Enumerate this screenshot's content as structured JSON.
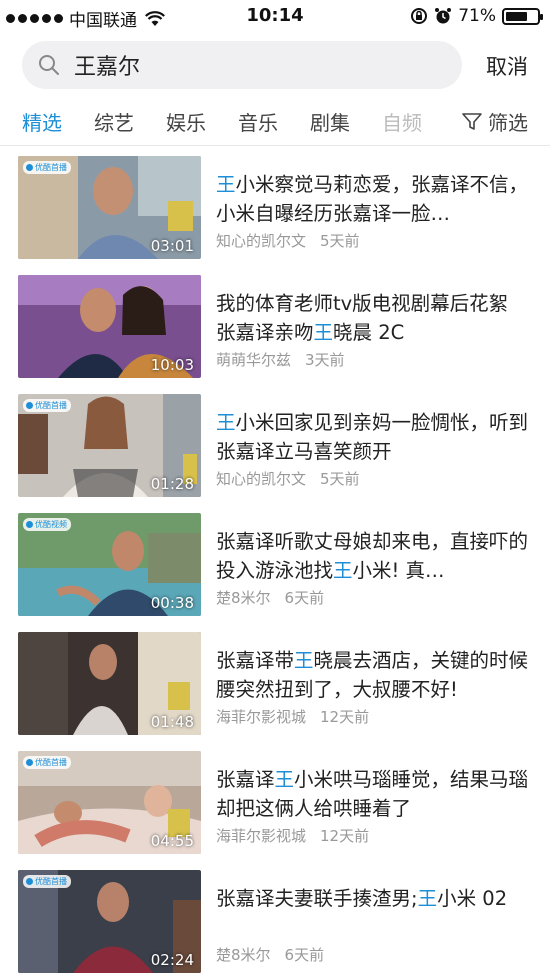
{
  "status_bar": {
    "carrier": "中国联通",
    "time": "10:14",
    "battery_percent": "71%",
    "battery_level": 0.71
  },
  "search": {
    "query": "王嘉尔",
    "cancel_label": "取消"
  },
  "tabs": {
    "items": [
      "精选",
      "综艺",
      "娱乐",
      "音乐",
      "剧集",
      "自频"
    ],
    "active": "精选",
    "filter_label": "筛选"
  },
  "results": [
    {
      "title_hl": "王",
      "title_rest": "小米察觉马莉恋爱，张嘉译不信，小米自曝经历张嘉译一脸…",
      "channel": "知心的凯尔文",
      "time": "5天前",
      "duration": "03:01",
      "badge": "优酷首播"
    },
    {
      "title_pre": "我的体育老师tv版电视剧幕后花絮 张嘉译亲吻",
      "title_hl": "王",
      "title_rest": "晓晨 2C",
      "channel": "萌萌华尔兹",
      "time": "3天前",
      "duration": "10:03"
    },
    {
      "title_hl": "王",
      "title_rest": "小米回家见到亲妈一脸惆怅，听到张嘉译立马喜笑颜开",
      "channel": "知心的凯尔文",
      "time": "5天前",
      "duration": "01:28",
      "badge": "优酷首播"
    },
    {
      "title_pre": "张嘉译听歌丈母娘却来电，直接吓的投入游泳池找",
      "title_hl": "王",
      "title_rest": "小米! 真…",
      "channel": "楚8米尔",
      "time": "6天前",
      "duration": "00:38",
      "badge": "优酷视频"
    },
    {
      "title_pre": "张嘉译带",
      "title_hl": "王",
      "title_rest": "晓晨去酒店，关键的时候腰突然扭到了，大叔腰不好!",
      "channel": "海菲尔影视城",
      "time": "12天前",
      "duration": "01:48"
    },
    {
      "title_pre": "张嘉译",
      "title_hl": "王",
      "title_rest": "小米哄马瑙睡觉，结果马瑙却把这俩人给哄睡着了",
      "channel": "海菲尔影视城",
      "time": "12天前",
      "duration": "04:55",
      "badge": "优酷首播"
    },
    {
      "title_pre": "张嘉译夫妻联手揍渣男;",
      "title_hl": "王",
      "title_rest": "小米 02",
      "channel": "楚8米尔",
      "time": "6天前",
      "duration": "02:24",
      "badge": "优酷首播"
    }
  ],
  "colors": {
    "accent": "#1e8fd6",
    "meta_text": "#999999",
    "search_bg": "#f0f0f2"
  }
}
